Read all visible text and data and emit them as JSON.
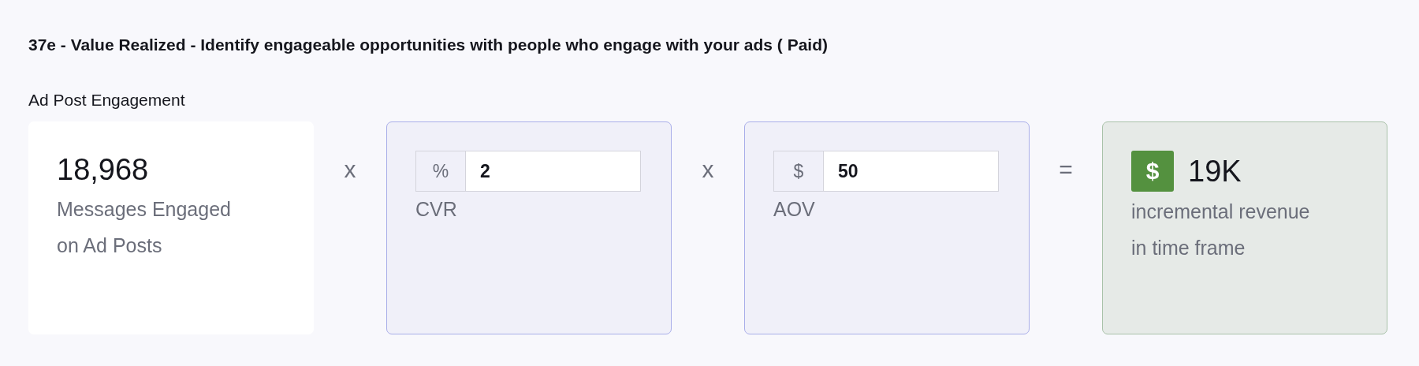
{
  "title": "37e - Value Realized - Identify engageable opportunities with people who engage with your ads ( Paid)",
  "section_label": "Ad Post Engagement",
  "items": [
    {
      "kind": "metric",
      "value": "18,968",
      "label": "Messages Engaged on Ad Posts"
    },
    {
      "kind": "operator",
      "symbol": "x"
    },
    {
      "kind": "input",
      "prefix": "%",
      "value": "2",
      "label": "CVR"
    },
    {
      "kind": "operator",
      "symbol": "x"
    },
    {
      "kind": "input",
      "prefix": "$",
      "value": "50",
      "label": "AOV"
    },
    {
      "kind": "operator",
      "symbol": "="
    },
    {
      "kind": "result",
      "icon": "$",
      "value": "19K",
      "label": "incremental revenue in time frame"
    }
  ]
}
